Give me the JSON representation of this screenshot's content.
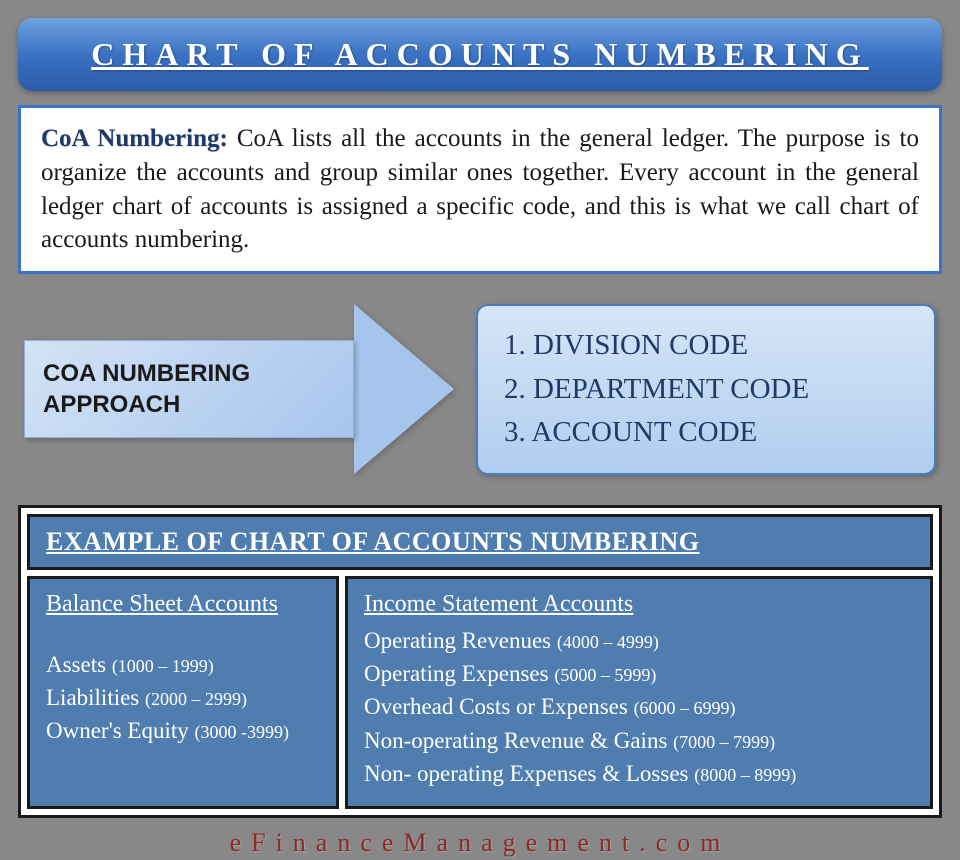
{
  "title": "CHART OF ACCOUNTS NUMBERING",
  "definition": {
    "label": "CoA Numbering:",
    "body": " CoA lists all the accounts in the general ledger. The purpose is to organize the accounts and group similar ones together. Every account in the general ledger chart of accounts is assigned a specific code, and this is what we call chart of accounts numbering."
  },
  "approach_label_line1": "COA NUMBERING",
  "approach_label_line2": "APPROACH",
  "codes": [
    "1. DIVISION CODE",
    "2. DEPARTMENT CODE",
    "3. ACCOUNT CODE"
  ],
  "example": {
    "header": "EXAMPLE OF CHART OF ACCOUNTS NUMBERING",
    "left": {
      "title": "Balance Sheet Accounts",
      "items": [
        {
          "name": "Assets",
          "range": "(1000 – 1999)"
        },
        {
          "name": "Liabilities",
          "range": "(2000 – 2999)"
        },
        {
          "name": "Owner's Equity",
          "range": "(3000 -3999)"
        }
      ]
    },
    "right": {
      "title": "Income Statement Accounts ",
      "items": [
        {
          "name": "Operating Revenues",
          "range": "(4000 – 4999)"
        },
        {
          "name": "Operating Expenses",
          "range": "(5000 – 5999)"
        },
        {
          "name": "Overhead Costs or Expenses",
          "range": "(6000 – 6999)"
        },
        {
          "name": "Non-operating Revenue & Gains",
          "range": "(7000 – 7999)"
        },
        {
          "name": "Non- operating Expenses & Losses",
          "range": "(8000 – 8999)"
        }
      ]
    }
  },
  "footer": "eFinanceManagement.com"
}
